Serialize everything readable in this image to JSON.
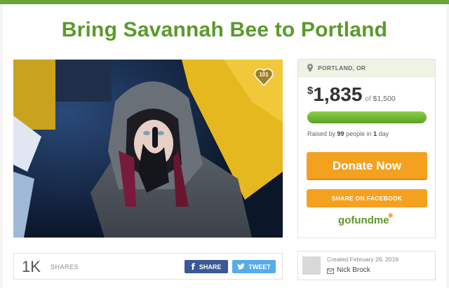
{
  "campaign": {
    "title": "Bring Savannah Bee to Portland",
    "hearts": "101"
  },
  "sidebar": {
    "location": "PORTLAND, OR",
    "currency_symbol": "$",
    "amount_raised": "1,835",
    "goal_prefix": "of",
    "goal": "$1,500",
    "progress_percent": 100,
    "raised_prefix": "Raised by",
    "people": "99",
    "people_suffix": "people in",
    "days": "1",
    "days_suffix": "day",
    "donate_label": "Donate Now",
    "facebook_label": "SHARE ON FACEBOOK",
    "logo_text": "gofundme"
  },
  "share": {
    "count": "1K",
    "label": "SHARES",
    "share_button": "SHARE",
    "tweet_button": "TWEET"
  },
  "organizer": {
    "created": "Created February 26, 2016",
    "name": "Nick Brock"
  },
  "colors": {
    "brand_green": "#5a9a2a",
    "donate_orange": "#f4a120",
    "facebook_blue": "#3b5998",
    "twitter_blue": "#55acee"
  },
  "icons": [
    "location-pin-icon",
    "heart-icon",
    "facebook-icon",
    "twitter-bird-icon",
    "mail-icon"
  ]
}
